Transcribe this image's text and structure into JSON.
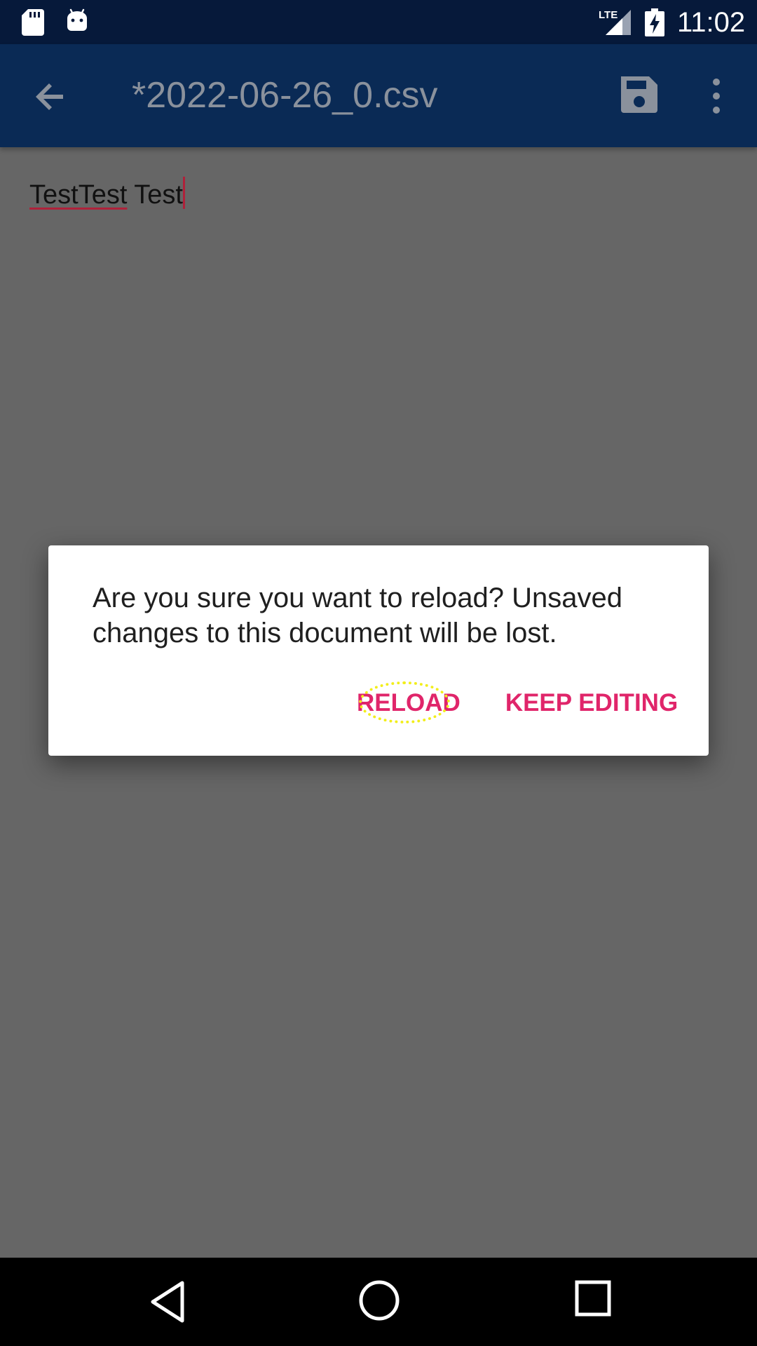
{
  "status_bar": {
    "icons": [
      "sd-card-icon",
      "android-debug-icon",
      "lte-signal-icon",
      "battery-charging-icon"
    ],
    "lte_label": "LTE",
    "time": "11:02"
  },
  "app_bar": {
    "back_icon": "arrow-back-icon",
    "title": "*2022-06-26_0.csv",
    "save_icon": "save-icon",
    "more_icon": "more-vert-icon"
  },
  "editor": {
    "word1": "TestTest",
    "word2": " Test"
  },
  "dialog": {
    "message": "Are you sure you want to reload? Unsaved changes to this document will be lost.",
    "reload_label": "RELOAD",
    "keep_label": "KEEP EDITING"
  },
  "nav_bar": {
    "icons": [
      "nav-back-icon",
      "nav-home-icon",
      "nav-recents-icon"
    ]
  },
  "colors": {
    "status_bar": "#06193a",
    "app_bar": "#0a2a55",
    "scrim": "#666666",
    "accent": "#e0256a",
    "highlight": "#f2ee1b"
  }
}
